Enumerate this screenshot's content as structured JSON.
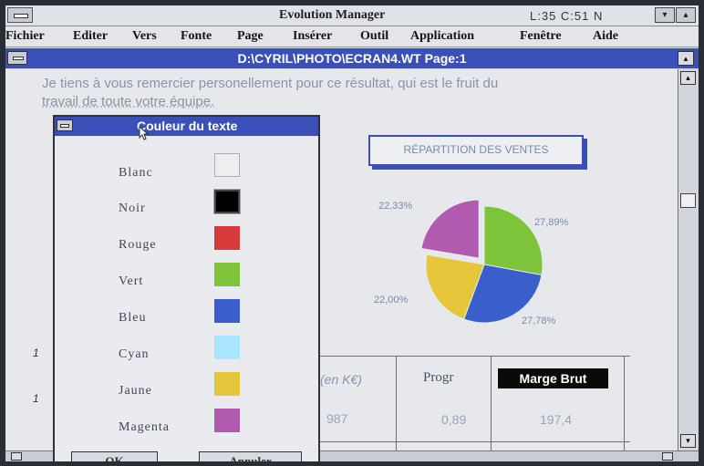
{
  "app": {
    "title": "Evolution Manager",
    "status": "L:35 C:51 N",
    "minimize_glyph": "▾",
    "maximize_glyph": "▴"
  },
  "menu": {
    "items": [
      "Fichier",
      "Editer",
      "Vers",
      "Fonte",
      "Page",
      "Insérer",
      "Outil",
      "Application",
      "Fenêtre",
      "Aide"
    ]
  },
  "document": {
    "title": "D:\\CYRIL\\PHOTO\\ECRAN4.WT Page:1",
    "text_line1": "Je tiens à vous remercier personellement pour ce résultat, qui est le fruit du",
    "text_line2": "travail de toute votre équipe.",
    "margin_marks": [
      "1",
      "1"
    ]
  },
  "chart_data": {
    "type": "pie",
    "title": "RÉPARTITION DES VENTES",
    "slices": [
      {
        "value": 27.89,
        "label": "27,89%",
        "color": "#7ec43a"
      },
      {
        "value": 27.78,
        "label": "27,78%",
        "color": "#3a5ecb"
      },
      {
        "value": 22.0,
        "label": "22,00%",
        "color": "#e6c63a"
      },
      {
        "value": 22.33,
        "label": "22,33%",
        "color": "#b25ab0",
        "exploded": true
      }
    ]
  },
  "table": {
    "headers": [
      "(en K€)",
      "Progr",
      "Marge Brut"
    ],
    "row": [
      "987",
      "0,89",
      "197,4"
    ]
  },
  "dialog": {
    "title": "Couleur du texte",
    "colors": [
      {
        "name": "Blanc",
        "hex": "#eeeeee"
      },
      {
        "name": "Noir",
        "hex": "#000000",
        "selected": true
      },
      {
        "name": "Rouge",
        "hex": "#d73a3a"
      },
      {
        "name": "Vert",
        "hex": "#7ec43a"
      },
      {
        "name": "Bleu",
        "hex": "#3a5ecb"
      },
      {
        "name": "Cyan",
        "hex": "#a9e6ff"
      },
      {
        "name": "Jaune",
        "hex": "#e6c63a"
      },
      {
        "name": "Magenta",
        "hex": "#b25ab0"
      }
    ],
    "ok_label": "OK",
    "cancel_label": "Annuler"
  },
  "colors": {
    "title_bar": "#3a4fb7"
  }
}
